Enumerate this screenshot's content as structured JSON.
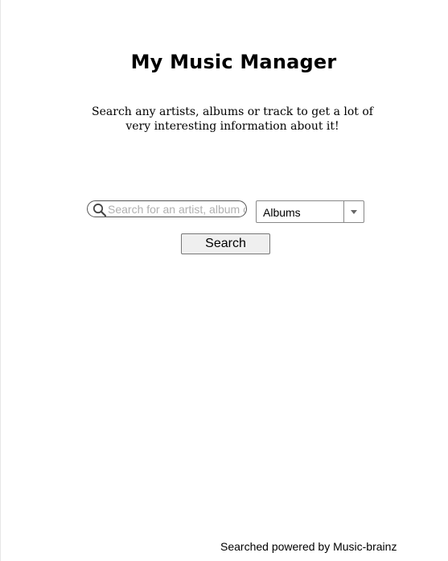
{
  "header": {
    "title": "My Music Manager",
    "subtitle": "Search any artists, albums or track to get a lot of very interesting information about it!"
  },
  "search": {
    "placeholder": "Search for an artist, album or track",
    "value": "",
    "icon": "search-icon"
  },
  "category_select": {
    "selected": "Albums",
    "icon": "chevron-down-icon"
  },
  "search_button": {
    "label": "Search"
  },
  "footer": {
    "credit": "Searched powered by Music-brainz"
  }
}
